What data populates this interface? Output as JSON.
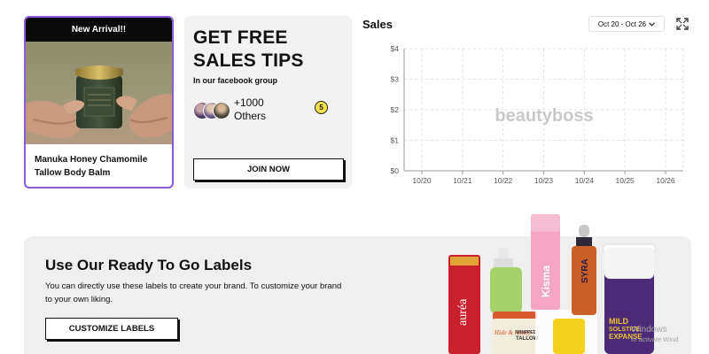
{
  "product": {
    "badge": "New Arrival!!",
    "name": "Manuka Honey Chamomile Tallow Body Balm",
    "jar_label": "Manuka Honey Chamomile Tallow Body Balm"
  },
  "tips": {
    "title_line1": "GET FREE",
    "title_line2": "SALES TIPS",
    "subtitle": "In our facebook group",
    "others_count": "+1000",
    "others_label": "Others",
    "coin": "5",
    "join_label": "JOIN NOW"
  },
  "sales": {
    "title": "Sales",
    "date_range": "Oct 20 - Oct 26",
    "dropdown_icon": "chevron-down-icon",
    "expand_icon": "expand-icon"
  },
  "chart_data": {
    "type": "line",
    "x": [
      "10/20",
      "10/21",
      "10/22",
      "10/23",
      "10/24",
      "10/25",
      "10/26"
    ],
    "series": [
      {
        "values": [
          0,
          0,
          0,
          0,
          0,
          0,
          0
        ]
      }
    ],
    "ylim": [
      0,
      4
    ],
    "yticks": [
      "$0",
      "$1",
      "$2",
      "$3",
      "$4"
    ],
    "watermark": "beautyboss",
    "grid": true
  },
  "labels": {
    "title": "Use Our Ready To Go Labels",
    "description": "You can directly use these labels to create your brand. To customize your brand to your own liking.",
    "button": "CUSTOMIZE LABELS",
    "product_texts": {
      "aurea": "auréa",
      "kisma": "Kisma",
      "syra": "SYRA",
      "mild": "MILD",
      "solstice": "SOLSTICE",
      "expanse": "EXPANSE",
      "hide": "Hide & Honey",
      "whipped": "WHIPPED",
      "tallow": "TALLOW"
    }
  },
  "system": {
    "watermark_line1": "Windows",
    "watermark_line2": "to activate Wind"
  },
  "colors": {
    "accent_border": "#8a5cd8",
    "button_border": "#111111",
    "banner_bg": "#efefef",
    "card_bg": "#f2f2f2"
  }
}
